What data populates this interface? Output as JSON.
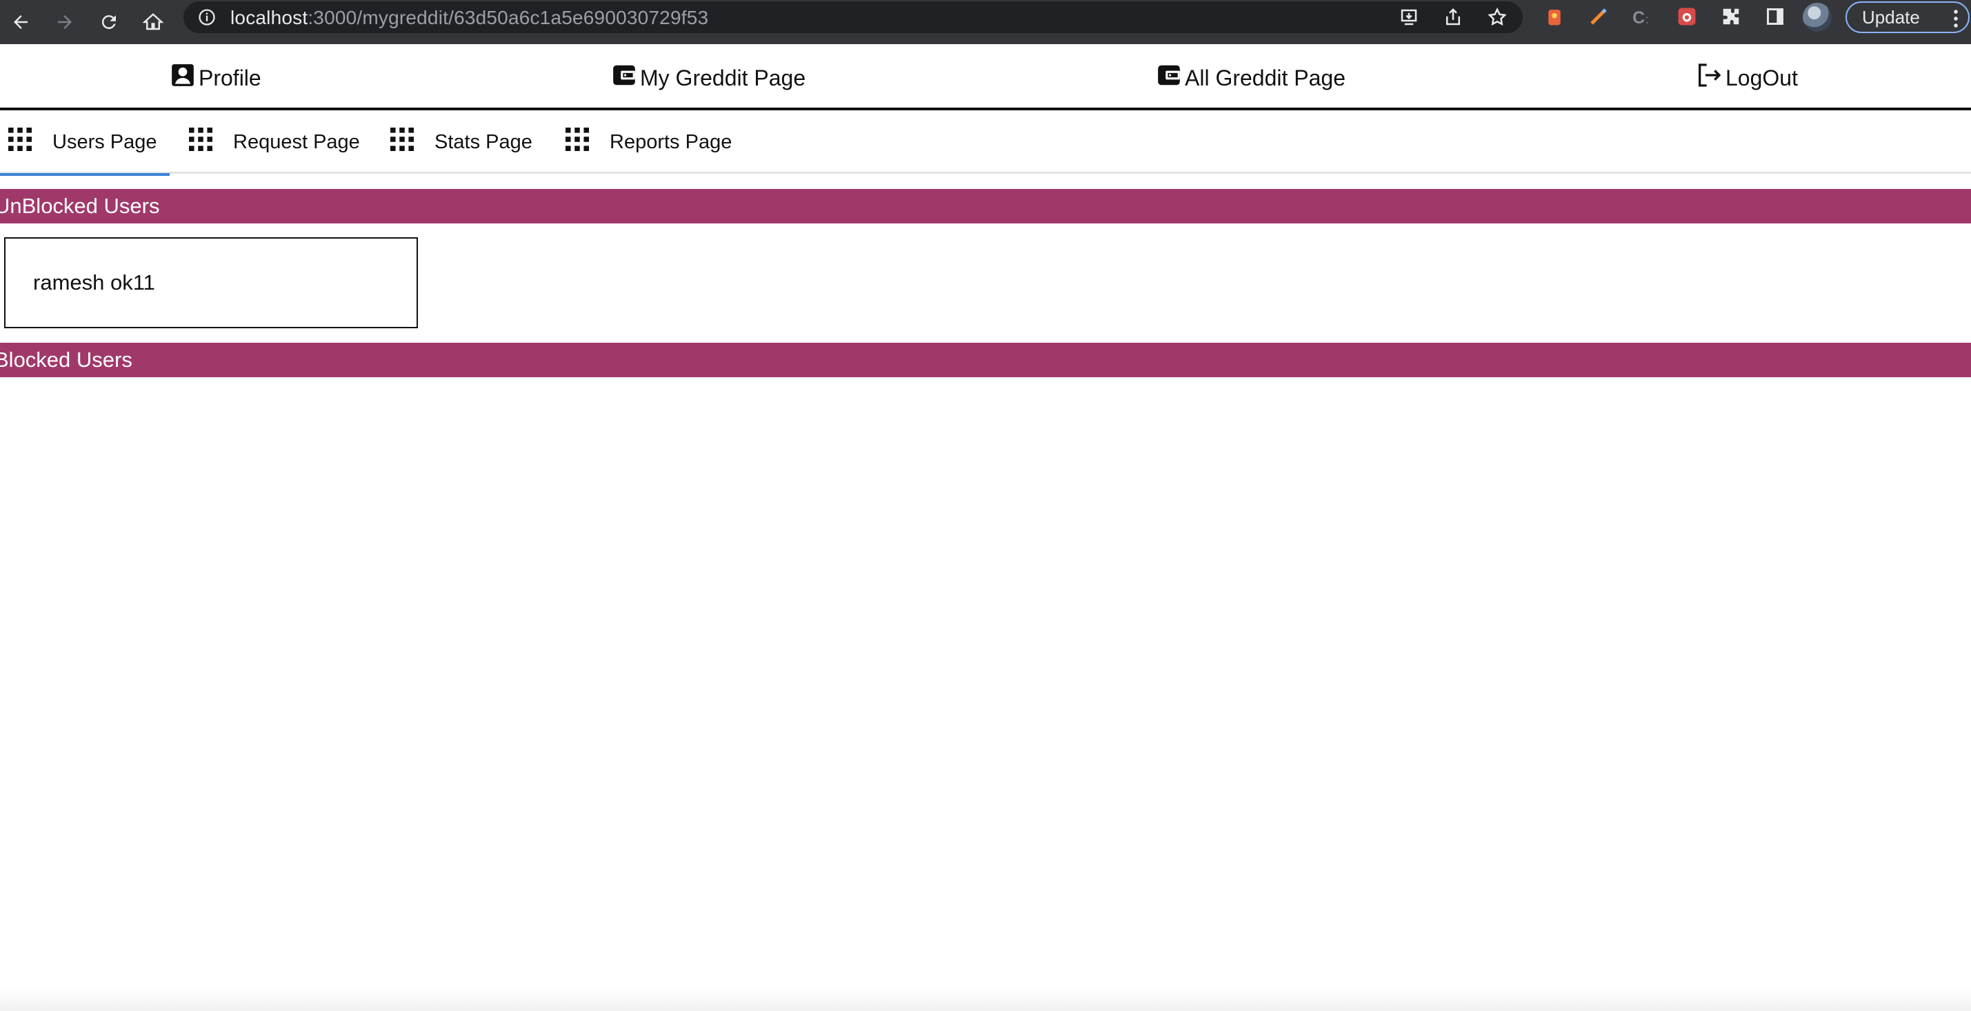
{
  "browser": {
    "url_host": "localhost",
    "url_rest": ":3000/mygreddit/63d50a6c1a5e690030729f53",
    "update_label": "Update"
  },
  "topnav": {
    "profile_label": "Profile",
    "my_greddit_label": "My Greddit Page",
    "all_greddit_label": "All Greddit Page",
    "logout_label": "LogOut"
  },
  "tabs": [
    {
      "label": "Users Page",
      "icon": "grid-icon",
      "active": true
    },
    {
      "label": "Request Page",
      "icon": "grid-icon",
      "active": false
    },
    {
      "label": "Stats Page",
      "icon": "grid-icon",
      "active": false
    },
    {
      "label": "Reports Page",
      "icon": "grid-icon",
      "active": false
    }
  ],
  "sections": {
    "unblocked_title": "UnBlocked Users",
    "blocked_title": "Blocked Users"
  },
  "unblocked_users": [
    {
      "name": "ramesh ok11"
    }
  ],
  "colors": {
    "section_bar": "#a0396a",
    "active_tab_underline": "#3b82d6",
    "chrome_bg": "#35363a"
  }
}
